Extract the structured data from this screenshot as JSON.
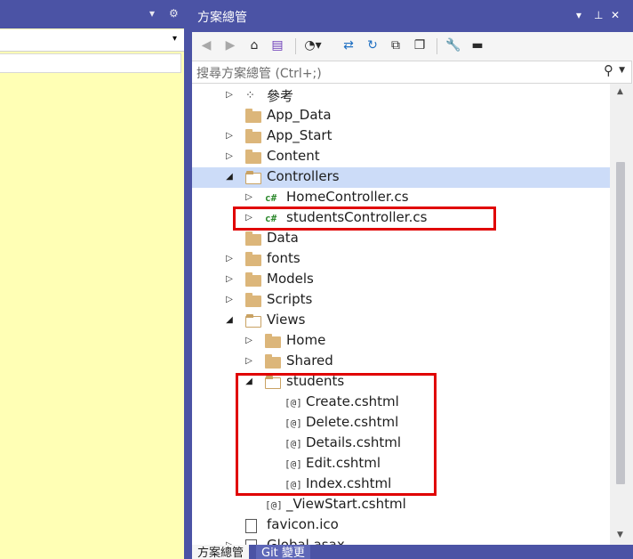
{
  "left_panel": {
    "title_buttons": [
      "▾",
      "⚙"
    ],
    "combo_arrow": "▾"
  },
  "explorer": {
    "title": "方案總管",
    "title_buttons": [
      "▾",
      "⊥",
      "✕"
    ],
    "search_placeholder": "搜尋方案總管 (Ctrl+;)",
    "toolbar_icons": [
      "back-icon",
      "forward-icon",
      "home-icon",
      "switch-views-icon",
      "pending-changes-filter-icon",
      "sync-icon",
      "refresh-icon",
      "collapse-all-icon",
      "show-all-files-icon",
      "properties-icon",
      "preview-icon"
    ],
    "tree": [
      {
        "label": "參考",
        "type": "ref",
        "indent": 0,
        "expander": "closed"
      },
      {
        "label": "App_Data",
        "type": "folder",
        "indent": 0,
        "expander": "none"
      },
      {
        "label": "App_Start",
        "type": "folder",
        "indent": 0,
        "expander": "closed"
      },
      {
        "label": "Content",
        "type": "folder",
        "indent": 0,
        "expander": "closed"
      },
      {
        "label": "Controllers",
        "type": "folder-open",
        "indent": 0,
        "expander": "open",
        "selected": true
      },
      {
        "label": "HomeController.cs",
        "type": "cs",
        "indent": 1,
        "expander": "closed"
      },
      {
        "label": "studentsController.cs",
        "type": "cs",
        "indent": 1,
        "expander": "closed"
      },
      {
        "label": "Data",
        "type": "folder",
        "indent": 0,
        "expander": "none"
      },
      {
        "label": "fonts",
        "type": "folder",
        "indent": 0,
        "expander": "closed"
      },
      {
        "label": "Models",
        "type": "folder",
        "indent": 0,
        "expander": "closed"
      },
      {
        "label": "Scripts",
        "type": "folder",
        "indent": 0,
        "expander": "closed"
      },
      {
        "label": "Views",
        "type": "folder-open",
        "indent": 0,
        "expander": "open"
      },
      {
        "label": "Home",
        "type": "folder",
        "indent": 1,
        "expander": "closed"
      },
      {
        "label": "Shared",
        "type": "folder",
        "indent": 1,
        "expander": "closed"
      },
      {
        "label": "students",
        "type": "folder-open",
        "indent": 1,
        "expander": "open"
      },
      {
        "label": "Create.cshtml",
        "type": "razor",
        "indent": 2,
        "expander": "none"
      },
      {
        "label": "Delete.cshtml",
        "type": "razor",
        "indent": 2,
        "expander": "none"
      },
      {
        "label": "Details.cshtml",
        "type": "razor",
        "indent": 2,
        "expander": "none"
      },
      {
        "label": "Edit.cshtml",
        "type": "razor",
        "indent": 2,
        "expander": "none"
      },
      {
        "label": "Index.cshtml",
        "type": "razor",
        "indent": 2,
        "expander": "none"
      },
      {
        "label": "_ViewStart.cshtml",
        "type": "razor",
        "indent": 1,
        "expander": "none"
      },
      {
        "label": "favicon.ico",
        "type": "file",
        "indent": 0,
        "expander": "none"
      },
      {
        "label": "Global.asax",
        "type": "file",
        "indent": 0,
        "expander": "closed"
      }
    ],
    "bottom_tabs": [
      {
        "label": "方案總管",
        "active": true
      },
      {
        "label": "Git 變更",
        "active": false
      }
    ],
    "highlight_color": "#e00000"
  }
}
